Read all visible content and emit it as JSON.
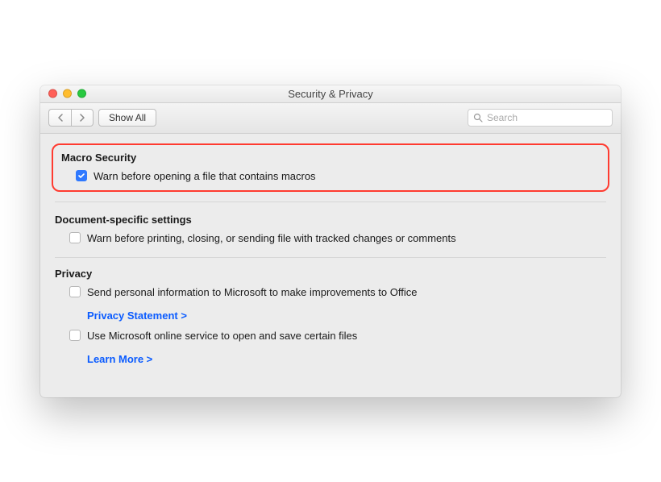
{
  "window": {
    "title": "Security & Privacy"
  },
  "toolbar": {
    "show_all": "Show All",
    "search_placeholder": "Search"
  },
  "sections": {
    "macro": {
      "heading": "Macro Security",
      "warn_macros": "Warn before opening a file that contains macros"
    },
    "doc": {
      "heading": "Document-specific settings",
      "warn_tracked": "Warn before printing, closing, or sending file with tracked changes or comments"
    },
    "privacy": {
      "heading": "Privacy",
      "send_info": "Send personal information to Microsoft to make improvements to Office",
      "privacy_link": "Privacy Statement >",
      "online_service": "Use Microsoft online service to open and save certain files",
      "learn_more": "Learn More >"
    }
  }
}
